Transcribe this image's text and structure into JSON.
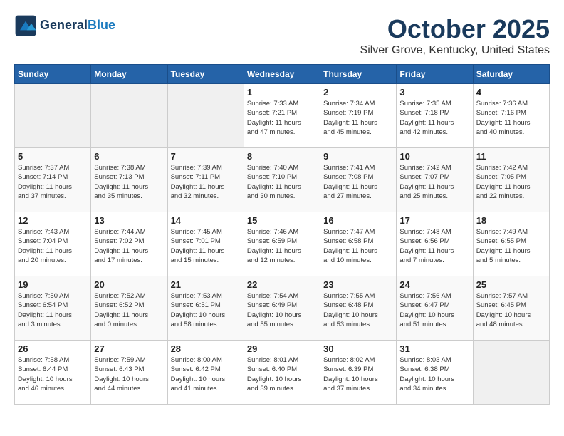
{
  "header": {
    "logo_line1": "General",
    "logo_line2": "Blue",
    "title": "October 2025",
    "subtitle": "Silver Grove, Kentucky, United States"
  },
  "days_of_week": [
    "Sunday",
    "Monday",
    "Tuesday",
    "Wednesday",
    "Thursday",
    "Friday",
    "Saturday"
  ],
  "weeks": [
    [
      {
        "day": "",
        "info": ""
      },
      {
        "day": "",
        "info": ""
      },
      {
        "day": "",
        "info": ""
      },
      {
        "day": "1",
        "info": "Sunrise: 7:33 AM\nSunset: 7:21 PM\nDaylight: 11 hours\nand 47 minutes."
      },
      {
        "day": "2",
        "info": "Sunrise: 7:34 AM\nSunset: 7:19 PM\nDaylight: 11 hours\nand 45 minutes."
      },
      {
        "day": "3",
        "info": "Sunrise: 7:35 AM\nSunset: 7:18 PM\nDaylight: 11 hours\nand 42 minutes."
      },
      {
        "day": "4",
        "info": "Sunrise: 7:36 AM\nSunset: 7:16 PM\nDaylight: 11 hours\nand 40 minutes."
      }
    ],
    [
      {
        "day": "5",
        "info": "Sunrise: 7:37 AM\nSunset: 7:14 PM\nDaylight: 11 hours\nand 37 minutes."
      },
      {
        "day": "6",
        "info": "Sunrise: 7:38 AM\nSunset: 7:13 PM\nDaylight: 11 hours\nand 35 minutes."
      },
      {
        "day": "7",
        "info": "Sunrise: 7:39 AM\nSunset: 7:11 PM\nDaylight: 11 hours\nand 32 minutes."
      },
      {
        "day": "8",
        "info": "Sunrise: 7:40 AM\nSunset: 7:10 PM\nDaylight: 11 hours\nand 30 minutes."
      },
      {
        "day": "9",
        "info": "Sunrise: 7:41 AM\nSunset: 7:08 PM\nDaylight: 11 hours\nand 27 minutes."
      },
      {
        "day": "10",
        "info": "Sunrise: 7:42 AM\nSunset: 7:07 PM\nDaylight: 11 hours\nand 25 minutes."
      },
      {
        "day": "11",
        "info": "Sunrise: 7:42 AM\nSunset: 7:05 PM\nDaylight: 11 hours\nand 22 minutes."
      }
    ],
    [
      {
        "day": "12",
        "info": "Sunrise: 7:43 AM\nSunset: 7:04 PM\nDaylight: 11 hours\nand 20 minutes."
      },
      {
        "day": "13",
        "info": "Sunrise: 7:44 AM\nSunset: 7:02 PM\nDaylight: 11 hours\nand 17 minutes."
      },
      {
        "day": "14",
        "info": "Sunrise: 7:45 AM\nSunset: 7:01 PM\nDaylight: 11 hours\nand 15 minutes."
      },
      {
        "day": "15",
        "info": "Sunrise: 7:46 AM\nSunset: 6:59 PM\nDaylight: 11 hours\nand 12 minutes."
      },
      {
        "day": "16",
        "info": "Sunrise: 7:47 AM\nSunset: 6:58 PM\nDaylight: 11 hours\nand 10 minutes."
      },
      {
        "day": "17",
        "info": "Sunrise: 7:48 AM\nSunset: 6:56 PM\nDaylight: 11 hours\nand 7 minutes."
      },
      {
        "day": "18",
        "info": "Sunrise: 7:49 AM\nSunset: 6:55 PM\nDaylight: 11 hours\nand 5 minutes."
      }
    ],
    [
      {
        "day": "19",
        "info": "Sunrise: 7:50 AM\nSunset: 6:54 PM\nDaylight: 11 hours\nand 3 minutes."
      },
      {
        "day": "20",
        "info": "Sunrise: 7:52 AM\nSunset: 6:52 PM\nDaylight: 11 hours\nand 0 minutes."
      },
      {
        "day": "21",
        "info": "Sunrise: 7:53 AM\nSunset: 6:51 PM\nDaylight: 10 hours\nand 58 minutes."
      },
      {
        "day": "22",
        "info": "Sunrise: 7:54 AM\nSunset: 6:49 PM\nDaylight: 10 hours\nand 55 minutes."
      },
      {
        "day": "23",
        "info": "Sunrise: 7:55 AM\nSunset: 6:48 PM\nDaylight: 10 hours\nand 53 minutes."
      },
      {
        "day": "24",
        "info": "Sunrise: 7:56 AM\nSunset: 6:47 PM\nDaylight: 10 hours\nand 51 minutes."
      },
      {
        "day": "25",
        "info": "Sunrise: 7:57 AM\nSunset: 6:45 PM\nDaylight: 10 hours\nand 48 minutes."
      }
    ],
    [
      {
        "day": "26",
        "info": "Sunrise: 7:58 AM\nSunset: 6:44 PM\nDaylight: 10 hours\nand 46 minutes."
      },
      {
        "day": "27",
        "info": "Sunrise: 7:59 AM\nSunset: 6:43 PM\nDaylight: 10 hours\nand 44 minutes."
      },
      {
        "day": "28",
        "info": "Sunrise: 8:00 AM\nSunset: 6:42 PM\nDaylight: 10 hours\nand 41 minutes."
      },
      {
        "day": "29",
        "info": "Sunrise: 8:01 AM\nSunset: 6:40 PM\nDaylight: 10 hours\nand 39 minutes."
      },
      {
        "day": "30",
        "info": "Sunrise: 8:02 AM\nSunset: 6:39 PM\nDaylight: 10 hours\nand 37 minutes."
      },
      {
        "day": "31",
        "info": "Sunrise: 8:03 AM\nSunset: 6:38 PM\nDaylight: 10 hours\nand 34 minutes."
      },
      {
        "day": "",
        "info": ""
      }
    ]
  ]
}
